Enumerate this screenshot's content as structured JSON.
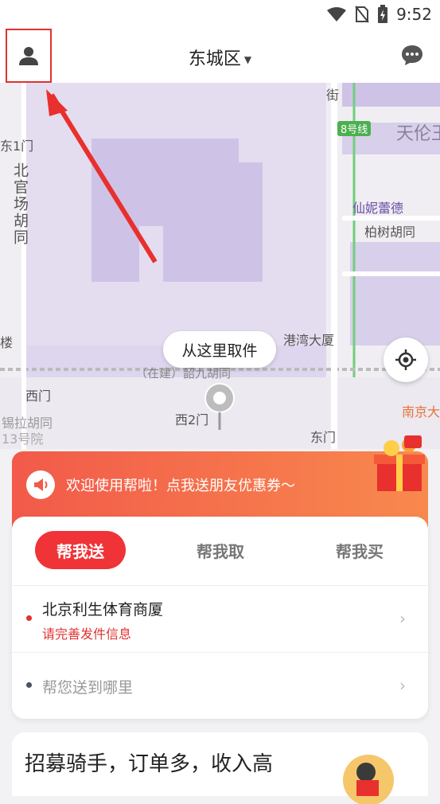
{
  "status_bar": {
    "time": "9:52"
  },
  "header": {
    "city": "东城区"
  },
  "map": {
    "labels": [
      "东1门",
      "北官场胡同",
      "街",
      "8号线",
      "天伦王",
      "仙妮蕾德",
      "柏树胡同",
      "港湾大厦",
      "（在建）韶九胡同",
      "西门",
      "锡拉胡同",
      "13号院",
      "西2门",
      "东门",
      "南京大",
      "楼"
    ],
    "pickup_bubble": "从这里取件"
  },
  "banner": {
    "text": "欢迎使用帮啦！点我送朋友优惠券～"
  },
  "tabs": [
    {
      "label": "帮我送"
    },
    {
      "label": "帮我取"
    },
    {
      "label": "帮我买"
    }
  ],
  "pickup": {
    "title": "北京利生体育商厦",
    "subtitle": "请完善发件信息"
  },
  "dropoff": {
    "placeholder": "帮您送到哪里"
  },
  "recruit": {
    "text": "招募骑手，订单多，收入高"
  },
  "colors": {
    "accent": "#ef3337",
    "banner_start": "#f25a4a",
    "banner_end": "#f8894e"
  }
}
